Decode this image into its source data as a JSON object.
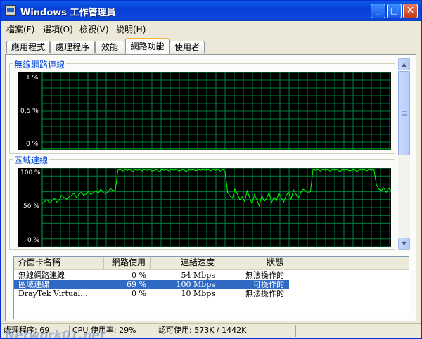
{
  "window": {
    "title": "Windows 工作管理員"
  },
  "title_buttons": {
    "minimize": "_",
    "maximize": "□",
    "close": "✕"
  },
  "menu": [
    {
      "label": "檔案(F)"
    },
    {
      "label": "選項(O)"
    },
    {
      "label": "檢視(V)"
    },
    {
      "label": "說明(H)"
    }
  ],
  "tabs": [
    {
      "label": "應用程式"
    },
    {
      "label": "處理程序"
    },
    {
      "label": "效能"
    },
    {
      "label": "網路功能",
      "active": true
    },
    {
      "label": "使用者"
    }
  ],
  "graphs": {
    "wireless": {
      "title": "無線網路連線",
      "y_labels": [
        "1 %",
        "0.5 %",
        "0 %"
      ]
    },
    "lan": {
      "title": "區域連線",
      "y_labels": [
        "100 %",
        "50 %",
        "0 %"
      ]
    }
  },
  "chart_data": [
    {
      "type": "line",
      "title": "無線網路連線",
      "ylim": [
        0,
        1
      ],
      "y_unit": "%",
      "grid": true,
      "values": [
        0,
        0,
        0,
        0,
        0,
        0,
        0,
        0,
        0,
        0,
        0,
        0,
        0,
        0,
        0,
        0,
        0,
        0,
        0,
        0,
        0,
        0,
        0,
        0,
        0,
        0,
        0,
        0,
        0,
        0,
        0,
        0,
        0,
        0,
        0,
        0,
        0,
        0,
        0,
        0,
        0,
        0,
        0,
        0,
        0,
        0,
        0,
        0,
        0,
        0,
        0,
        0,
        0,
        0,
        0,
        0,
        0,
        0,
        0,
        0
      ],
      "color": "#00ff00"
    },
    {
      "type": "line",
      "title": "區域連線",
      "ylim": [
        0,
        100
      ],
      "y_unit": "%",
      "grid": true,
      "color": "#00ff00",
      "values": [
        55,
        58,
        60,
        56,
        59,
        62,
        57,
        60,
        66,
        63,
        61,
        64,
        66,
        69,
        63,
        67,
        70,
        66,
        68,
        71,
        67,
        70,
        72,
        69,
        74,
        70,
        68,
        71,
        75,
        72,
        73,
        99,
        100,
        98,
        100,
        99,
        100,
        97,
        100,
        99,
        100,
        98,
        100,
        99,
        100,
        98,
        99,
        100,
        97,
        100,
        99,
        100,
        98,
        100,
        99,
        100,
        98,
        99,
        100,
        97,
        100,
        99,
        100,
        98,
        100,
        99,
        100,
        99,
        100,
        98,
        100,
        99,
        100,
        98,
        100,
        97,
        70,
        65,
        62,
        74,
        68,
        60,
        64,
        58,
        72,
        63,
        55,
        67,
        60,
        52,
        66,
        58,
        62,
        70,
        56,
        64,
        59,
        69,
        63,
        57,
        66,
        70,
        61,
        73,
        68,
        62,
        70,
        74,
        72,
        69,
        71,
        100,
        99,
        100,
        98,
        100,
        99,
        100,
        98,
        100,
        99,
        100,
        97,
        100,
        99,
        100,
        98,
        99,
        100,
        97,
        100,
        99,
        100,
        98,
        100,
        99,
        100,
        80,
        74,
        72,
        76,
        70,
        75,
        73
      ]
    }
  ],
  "list": {
    "columns": [
      "介面卡名稱",
      "網路使用",
      "連結速度",
      "狀態"
    ],
    "rows": [
      {
        "name": "無線網路連線",
        "usage": "0 %",
        "speed": "54 Mbps",
        "state": "無法操作的",
        "selected": false
      },
      {
        "name": "區域連線",
        "usage": "69 %",
        "speed": "100 Mbps",
        "state": "可操作的",
        "selected": true
      },
      {
        "name": "DrayTek Virtual...",
        "usage": "0 %",
        "speed": "10 Mbps",
        "state": "無法操作的",
        "selected": false
      }
    ]
  },
  "status": {
    "processes": "處理程序: 69",
    "cpu": "CPU 使用率: 29%",
    "commit": "認可使用: 573K / 1442K"
  },
  "watermark": "Network01.net"
}
